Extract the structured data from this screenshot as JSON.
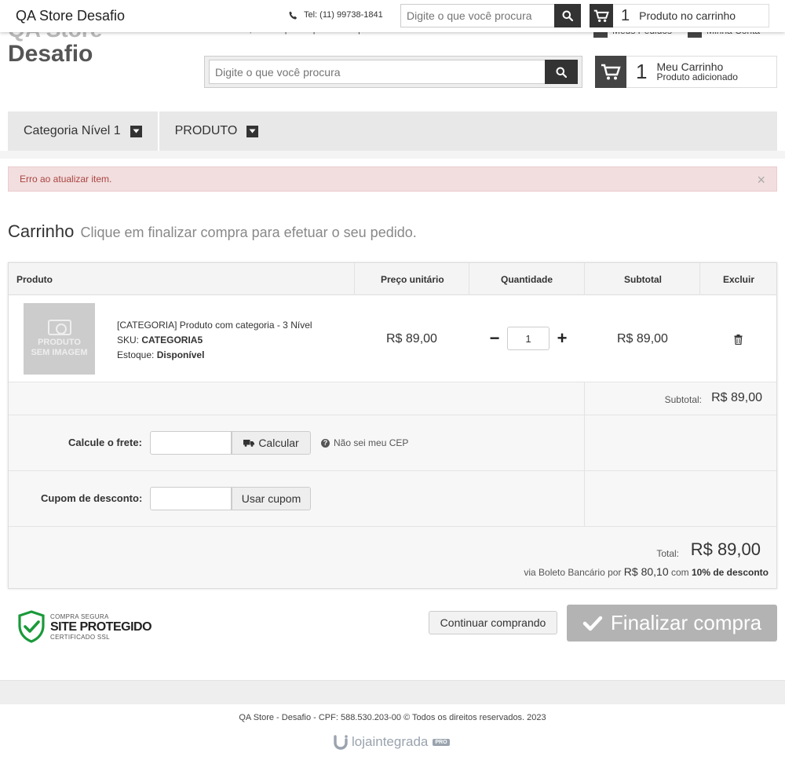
{
  "topbar": {
    "store_name": "QA Store Desafio",
    "phone": "Tel: (11) 99738-1841",
    "search_placeholder": "Digite o que você procura",
    "cart_count": "1",
    "cart_text": "Produto no carrinho"
  },
  "header": {
    "ghost_brand": "QA Store",
    "store_name": "Desafio",
    "welcome": "Bem-vindo, identifique-se para fazer pedidos",
    "my_orders": "Meus Pedidos",
    "my_account": "Minha Conta",
    "search_placeholder": "Digite o que você procura",
    "cart_count": "1",
    "cart_title": "Meu Carrinho",
    "cart_subtitle": "Produto adicionado"
  },
  "menu": {
    "items": [
      {
        "label": "Categoria Nível 1"
      },
      {
        "label": "PRODUTO"
      }
    ]
  },
  "alert": {
    "message": "Erro ao atualizar item.",
    "close": "×"
  },
  "page": {
    "title": "Carrinho",
    "subtitle": "Clique em finalizar compra para efetuar o seu pedido."
  },
  "table": {
    "headers": {
      "product": "Produto",
      "unit_price": "Preço unitário",
      "quantity": "Quantidade",
      "subtotal": "Subtotal",
      "remove": "Excluir"
    },
    "items": [
      {
        "image_label_1": "PRODUTO",
        "image_label_2": "SEM IMAGEM",
        "name": "[CATEGORIA] Produto com categoria - 3 Nível",
        "sku_label": "SKU:",
        "sku": "CATEGORIA5",
        "stock_label": "Estoque:",
        "stock": "Disponível",
        "unit_price": "R$ 89,00",
        "quantity": "1",
        "minus": "−",
        "plus": "+",
        "subtotal": "R$ 89,00"
      }
    ],
    "subtotal_label": "Subtotal:",
    "subtotal_value": "R$ 89,00",
    "shipping": {
      "label": "Calcule o frete:",
      "button": "Calcular",
      "help": "Não sei meu CEP"
    },
    "coupon": {
      "label": "Cupom de desconto:",
      "button": "Usar cupom"
    },
    "total": {
      "label": "Total:",
      "value": "R$ 89,00",
      "boleto_prefix": "via Boleto Bancário por",
      "boleto_price": "R$ 80,10",
      "boleto_with": "com",
      "boleto_discount": "10% de desconto"
    }
  },
  "actions": {
    "seal_small_top": "COMPRA SEGURA",
    "seal_big": "SITE PROTEGIDO",
    "seal_small_bottom": "CERTIFICADO SSL",
    "continue": "Continuar comprando",
    "checkout": "Finalizar compra"
  },
  "footer": {
    "copyright": "QA Store - Desafio - CPF: 588.530.203-00 © Todos os direitos reservados. 2023",
    "platform_a": "loja",
    "platform_b": "integrada",
    "platform_badge": "PRO"
  },
  "colors": {
    "dark": "#333333",
    "alert_bg": "#f2dede",
    "alert_text": "#a94442",
    "checkout_disabled": "#b3b3b3",
    "seal_green": "#1a9a3a"
  }
}
